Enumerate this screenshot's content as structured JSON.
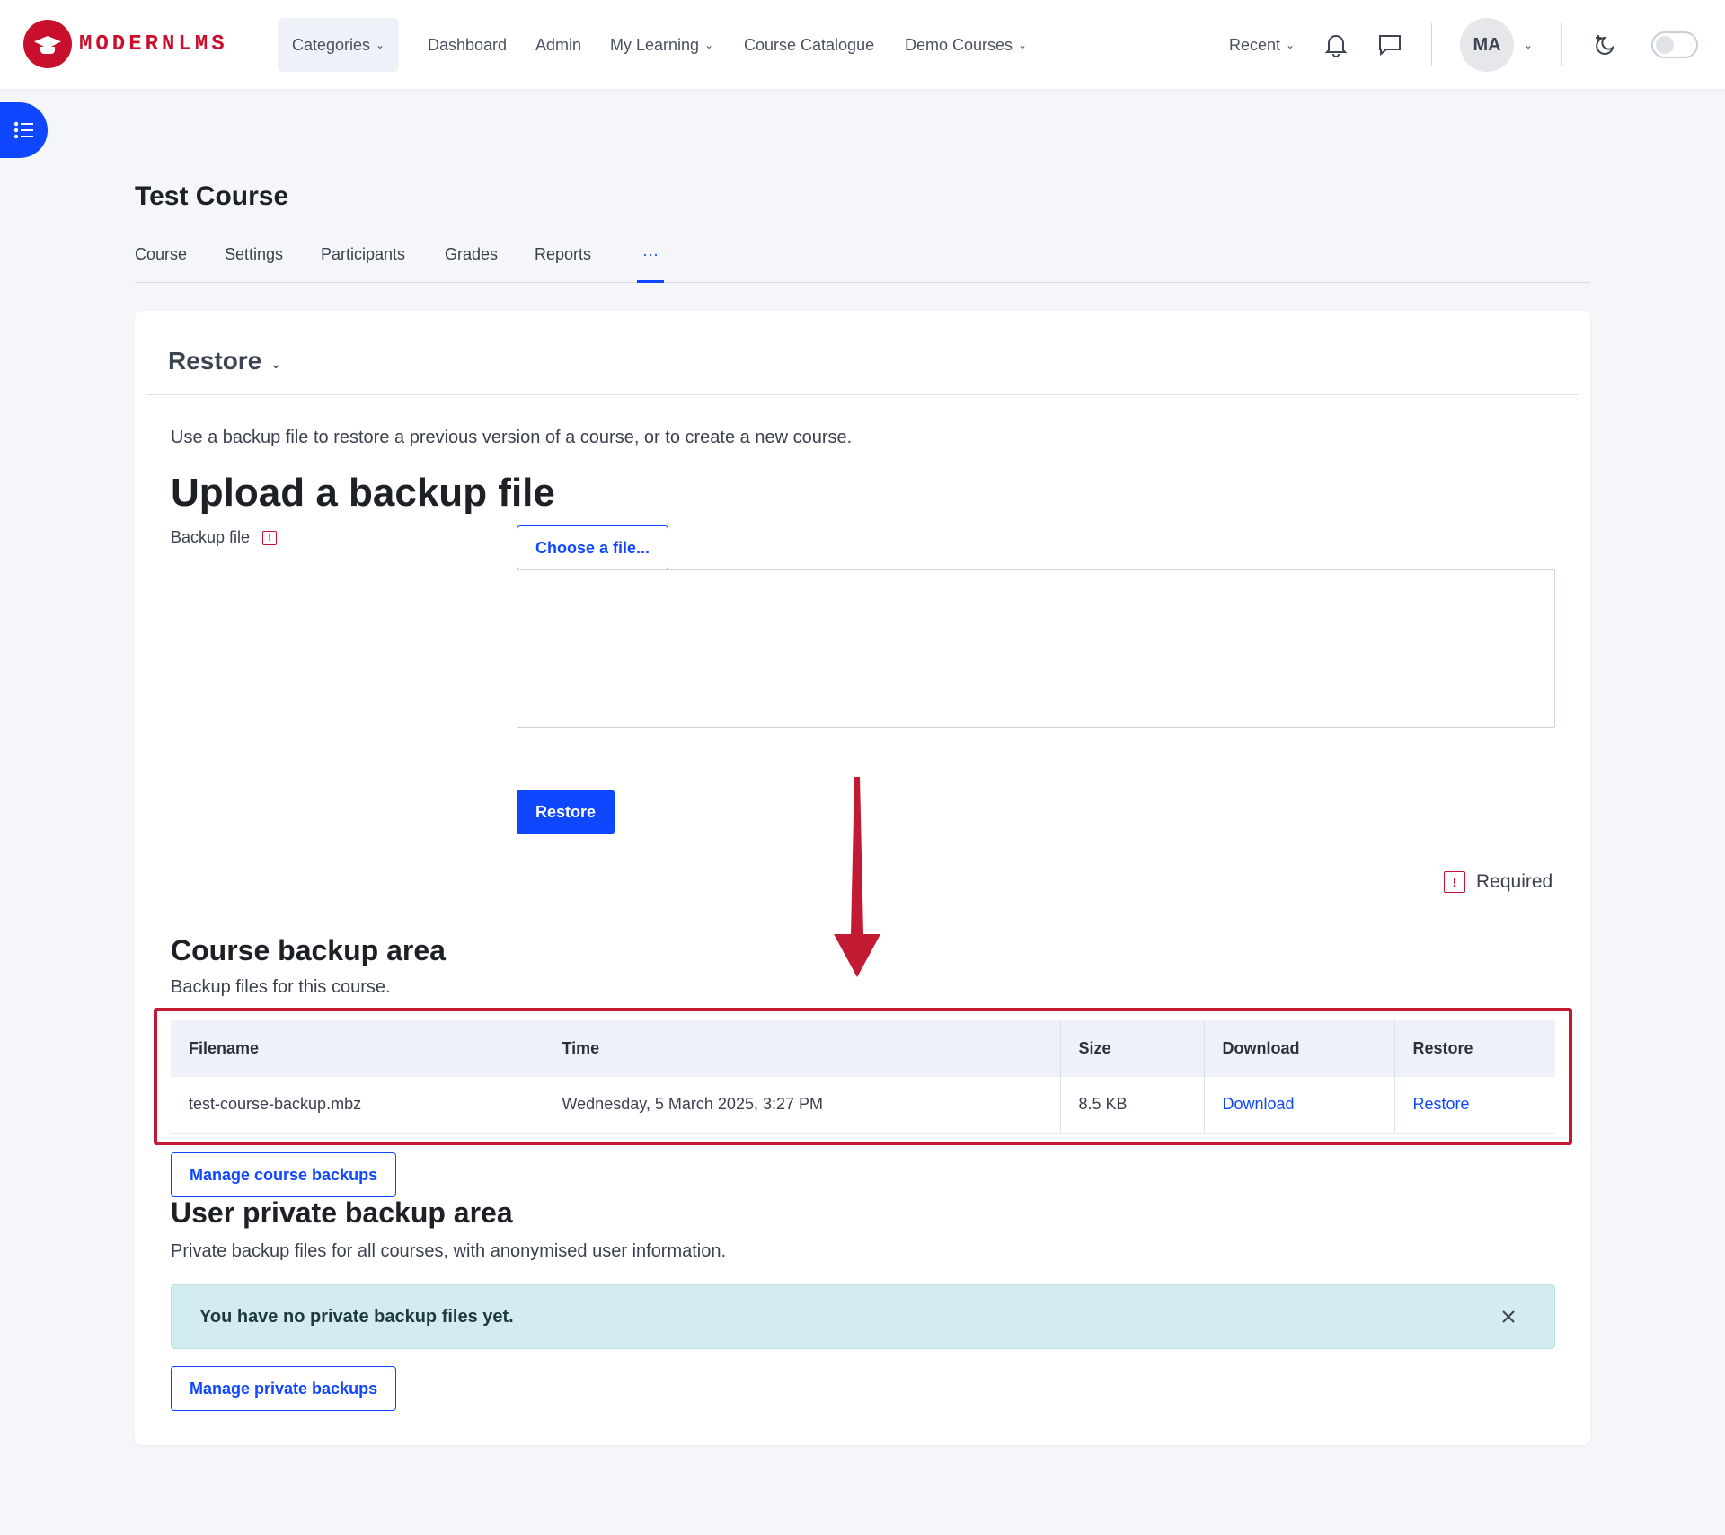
{
  "brand": {
    "name": "MODERNLMS",
    "color": "#c8102e"
  },
  "navbar": {
    "items": [
      {
        "label": "Categories",
        "has_menu": true
      },
      {
        "label": "Dashboard",
        "has_menu": false
      },
      {
        "label": "Admin",
        "has_menu": false
      },
      {
        "label": "My Learning",
        "has_menu": true
      },
      {
        "label": "Course Catalogue",
        "has_menu": false
      },
      {
        "label": "Demo Courses",
        "has_menu": true
      }
    ],
    "recent_label": "Recent",
    "user_initials": "MA",
    "icons": [
      "bell-icon",
      "chat-icon",
      "chevron-down-icon",
      "dark-mode-icon",
      "toggle-switch"
    ]
  },
  "course": {
    "title": "Test Course",
    "tabs": [
      "Course",
      "Settings",
      "Participants",
      "Grades",
      "Reports",
      "···"
    ],
    "active_tab": "···"
  },
  "restore": {
    "heading": "Restore",
    "intro": "Use a backup file to restore a previous version of a course, or to create a new course.",
    "upload_heading": "Upload a backup file",
    "backup_file_label": "Backup file",
    "choose_file_label": "Choose a file...",
    "restore_button": "Restore",
    "required_label": "Required"
  },
  "course_backup": {
    "heading": "Course backup area",
    "description": "Backup files for this course.",
    "columns": [
      "Filename",
      "Time",
      "Size",
      "Download",
      "Restore"
    ],
    "rows": [
      {
        "filename": "test-course-backup.mbz",
        "time": "Wednesday, 5 March 2025, 3:27 PM",
        "size": "8.5 KB",
        "download": "Download",
        "restore": "Restore"
      }
    ],
    "manage_button": "Manage course backups"
  },
  "user_backup": {
    "heading": "User private backup area",
    "description": "Private backup files for all courses, with anonymised user information.",
    "alert": "You have no private backup files yet.",
    "manage_button": "Manage private backups"
  },
  "colors": {
    "primary": "#0f47ff",
    "highlight": "#c21a32",
    "alert_bg": "#d2ecef"
  }
}
